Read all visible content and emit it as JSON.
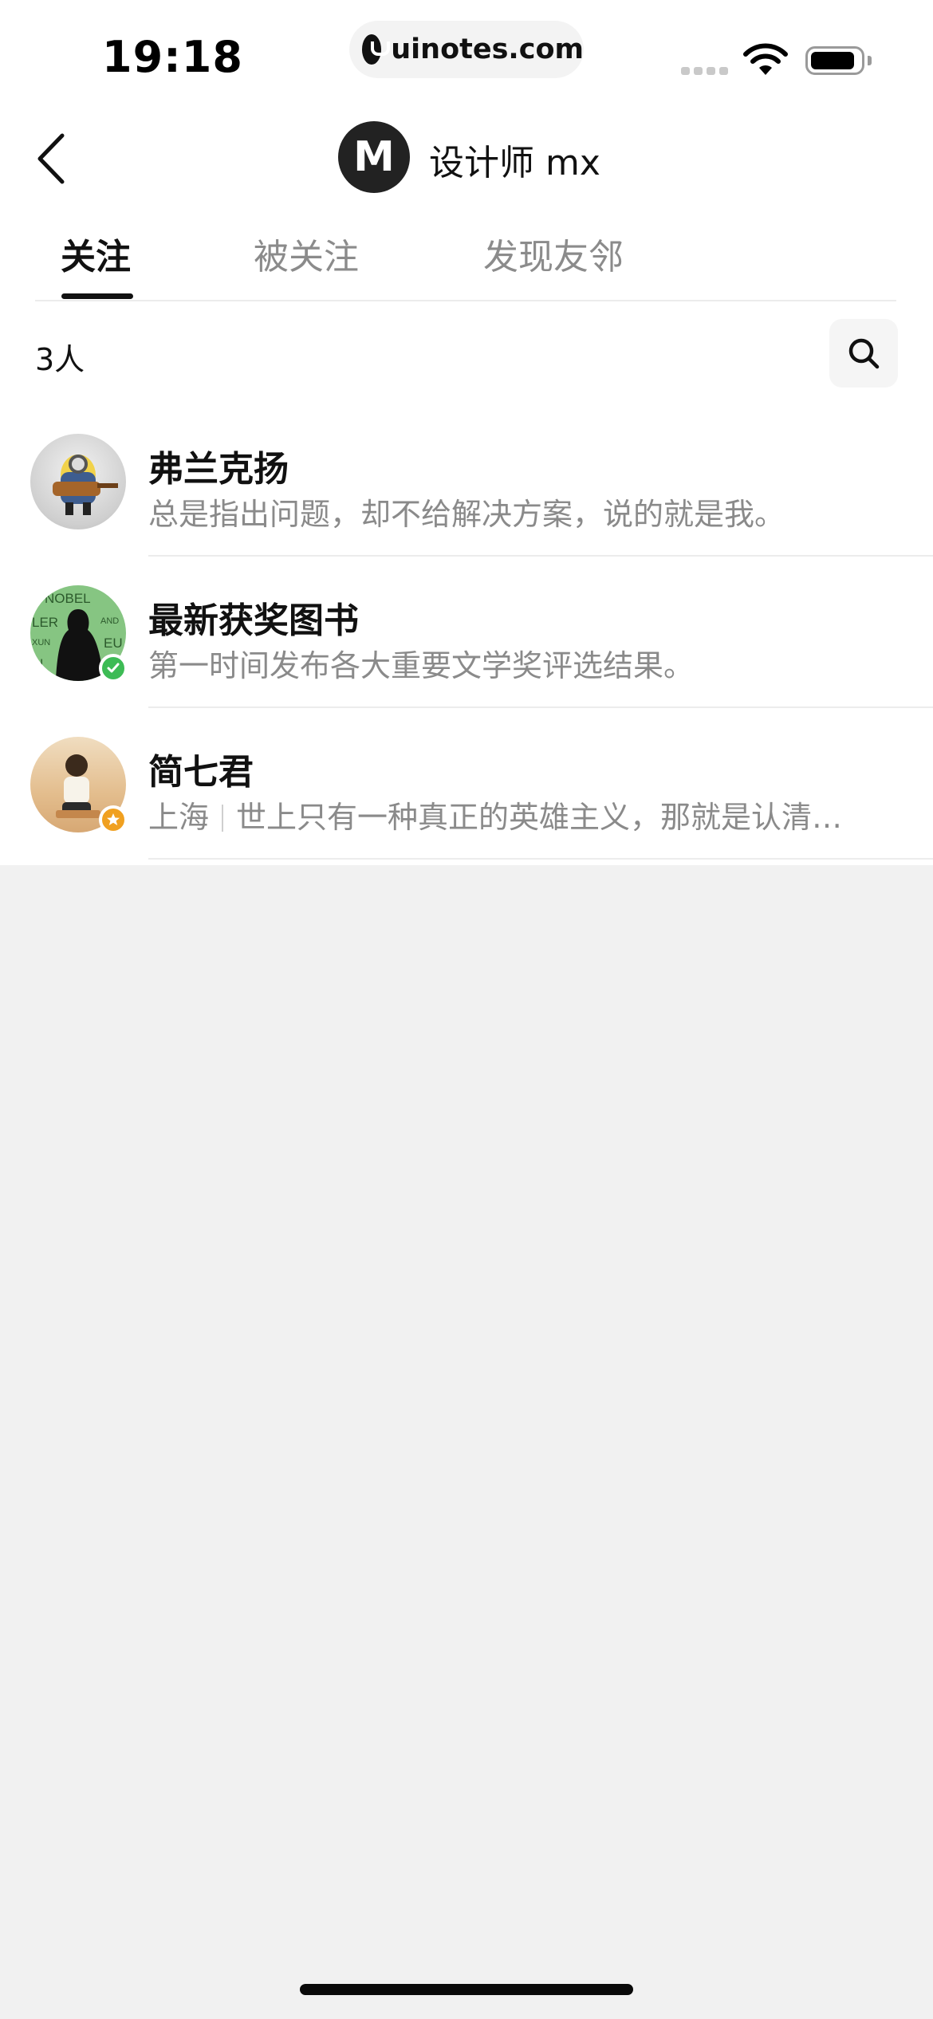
{
  "status_bar": {
    "time": "19:18",
    "url": "uinotes.com"
  },
  "header": {
    "back_icon": "chevron-left-icon",
    "avatar_letter": "M",
    "title": "设计师 mx"
  },
  "tabs": [
    {
      "label": "关注",
      "active": true
    },
    {
      "label": "被关注",
      "active": false
    },
    {
      "label": "发现友邻",
      "active": false
    }
  ],
  "list_header": {
    "count": "3人",
    "search_icon": "search-icon"
  },
  "following": [
    {
      "name": "弗兰克扬",
      "desc": "总是指出问题，却不给解决方案，说的就是我。",
      "avatar_color": "#e7d24a"
    },
    {
      "name": "最新获奖图书",
      "desc": "第一时间发布各大重要文学奖评选结果。",
      "avatar_color": "#7fc07a",
      "avatar_text": [
        "NOBEL",
        "LER",
        "AND",
        "XUN",
        "EU",
        "N"
      ],
      "badge": "check-icon",
      "badge_color": "#3dbb55"
    },
    {
      "name": "简七君",
      "location": "上海",
      "desc": "世上只有一种真正的英雄主义，那就是认清…",
      "avatar_color": "#e9c99c",
      "badge": "star-icon",
      "badge_color": "#f0a020"
    }
  ],
  "colors": {
    "background": "#f1f1f1",
    "card": "#ffffff",
    "text_primary": "#111111",
    "text_secondary": "#8a8a8a"
  }
}
